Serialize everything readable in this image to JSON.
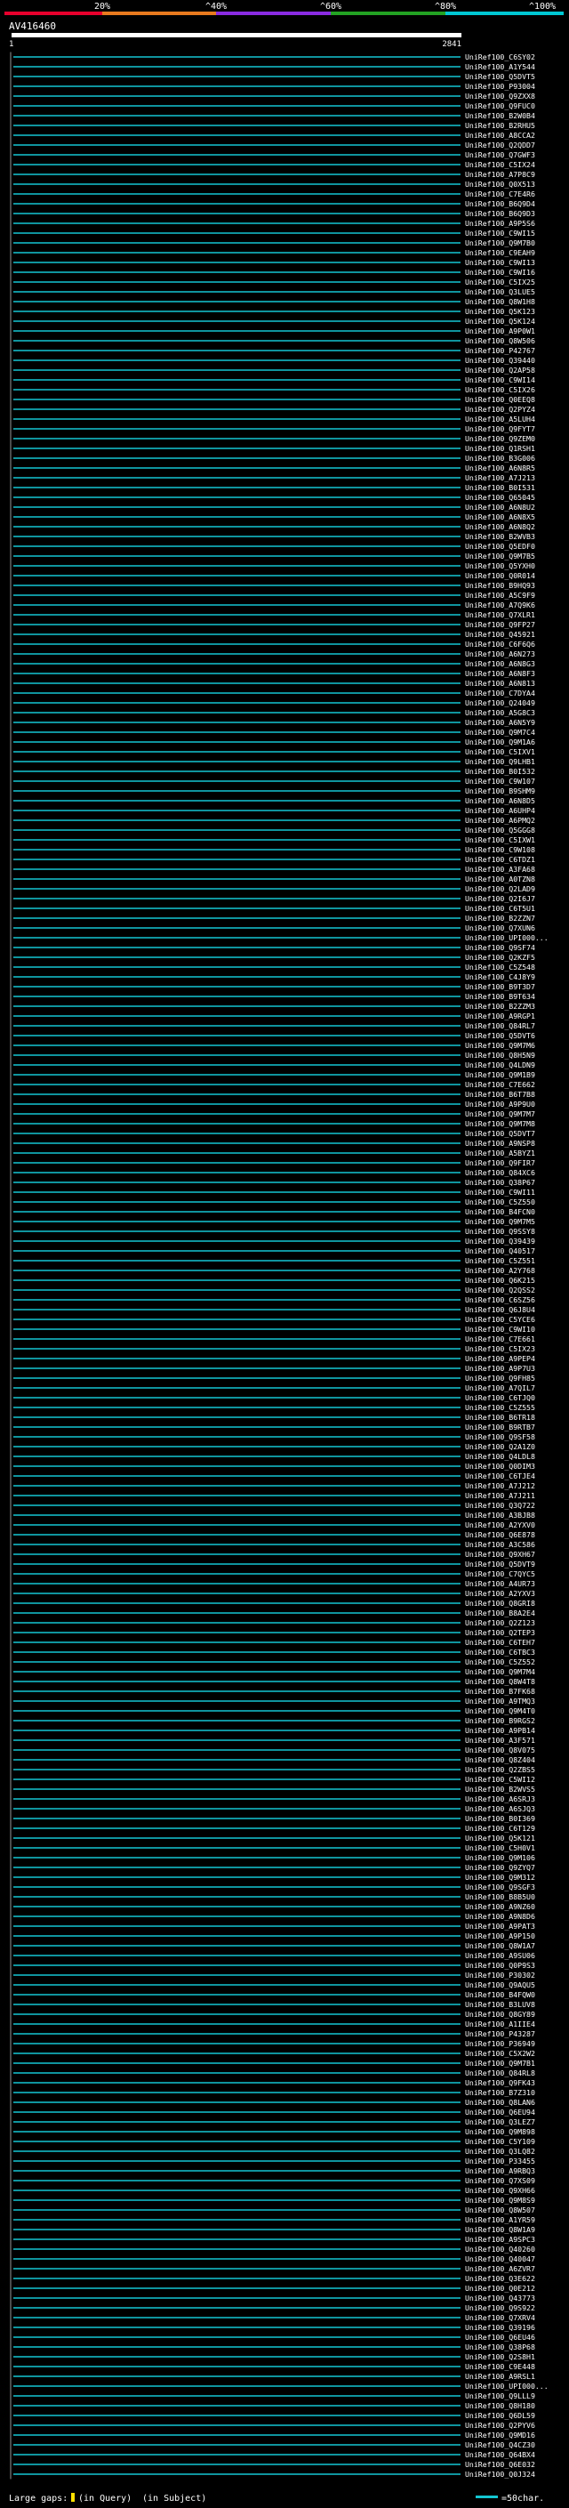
{
  "header": {
    "scale_labels": [
      "20%",
      "^40%",
      "^60%",
      "^80%",
      "^100%"
    ],
    "scale_colors": [
      "#e8002d",
      "#e87a1e",
      "#8a2be2",
      "#23a323",
      "#00c8d4"
    ],
    "query_id": "AV416460",
    "ruler_start": "1",
    "ruler_end": "2841"
  },
  "chart_data": {
    "type": "alignment",
    "query_length": 2841,
    "colors": {
      "high_identity": "#14c6d2",
      "mid_identity": "#3fae2a",
      "gap": "#ffffff",
      "frame": "#2a4a7a"
    },
    "hits": [
      "UniRef100_C6SY02",
      "UniRef100_A1Y544",
      "UniRef100_Q5DVT5",
      "UniRef100_P93004",
      "UniRef100_Q9ZXX8",
      "UniRef100_Q9FUC0",
      "UniRef100_B2W0B4",
      "UniRef100_B2RHU5",
      "UniRef100_A8CCA2",
      "UniRef100_Q2QDD7",
      "UniRef100_Q7GWF3",
      "UniRef100_C5IX24",
      "UniRef100_A7P8C9",
      "UniRef100_Q0X513",
      "UniRef100_C7E4R6",
      "UniRef100_B6Q9D4",
      "UniRef100_B6Q9D3",
      "UniRef100_A9P5S6",
      "UniRef100_C9WI15",
      "UniRef100_Q9M7B0",
      "UniRef100_C9EAH9",
      "UniRef100_C9WI13",
      "UniRef100_C9WI16",
      "UniRef100_C5IX25",
      "UniRef100_Q3LUE5",
      "UniRef100_Q8W1H8",
      "UniRef100_Q5K123",
      "UniRef100_Q5K124",
      "UniRef100_A9P0W1",
      "UniRef100_Q8W506",
      "UniRef100_P42767",
      "UniRef100_Q39440",
      "UniRef100_Q2AP58",
      "UniRef100_C9WI14",
      "UniRef100_C5IX26",
      "UniRef100_Q0EEQ8",
      "UniRef100_Q2PYZ4",
      "UniRef100_A5LUH4",
      "UniRef100_Q9FYT7",
      "UniRef100_Q9ZEM0",
      "UniRef100_Q1RSH1",
      "UniRef100_B3G006",
      "UniRef100_A6N8R5",
      "UniRef100_A7J213",
      "UniRef100_B0I531",
      "UniRef100_Q65045",
      "UniRef100_A6N8U2",
      "UniRef100_A6N8X5",
      "UniRef100_A6N8Q2",
      "UniRef100_B2WVB3",
      "UniRef100_Q5EDF0",
      "UniRef100_Q9M7B5",
      "UniRef100_Q5YXH0",
      "UniRef100_Q0R014",
      "UniRef100_B9HQ93",
      "UniRef100_A5C9F9",
      "UniRef100_A7Q9K6",
      "UniRef100_Q7XLR1",
      "UniRef100_Q9FP27",
      "UniRef100_Q45921",
      "UniRef100_C6F6Q6",
      "UniRef100_A6N273",
      "UniRef100_A6N8G3",
      "UniRef100_A6N8F3",
      "UniRef100_A6N813",
      "UniRef100_C7DYA4",
      "UniRef100_Q24049",
      "UniRef100_A5G8C3",
      "UniRef100_A6N5Y9",
      "UniRef100_Q9M7C4",
      "UniRef100_Q9M1A6",
      "UniRef100_C5IXV1",
      "UniRef100_Q9LHB1",
      "UniRef100_B0I532",
      "UniRef100_C9W107",
      "UniRef100_B9SHM9",
      "UniRef100_A6N8D5",
      "UniRef100_A6UHP4",
      "UniRef100_A6PMQ2",
      "UniRef100_Q5GGG8",
      "UniRef100_C5IXW1",
      "UniRef100_C9W108",
      "UniRef100_C6TDZ1",
      "UniRef100_A3FA68",
      "UniRef100_A0TZN8",
      "UniRef100_Q2LAD9",
      "UniRef100_Q2I6J7",
      "UniRef100_C6T5U1",
      "UniRef100_B2ZZN7",
      "UniRef100_Q7XUN6",
      "UniRef100_UPI000...",
      "UniRef100_Q9SF74",
      "UniRef100_Q2KZF5",
      "UniRef100_C5Z548",
      "UniRef100_C4J8Y9",
      "UniRef100_B9T3D7",
      "UniRef100_B9T634",
      "UniRef100_B2ZZM3",
      "UniRef100_A9RGP1",
      "UniRef100_Q84RL7",
      "UniRef100_Q5DVT6",
      "UniRef100_Q9M7M6",
      "UniRef100_Q8H5N9",
      "UniRef100_Q4LDN9",
      "UniRef100_Q9M1B9",
      "UniRef100_C7E662",
      "UniRef100_B6T7B8",
      "UniRef100_A9P9U0",
      "UniRef100_Q9M7M7",
      "UniRef100_Q9M7M8",
      "UniRef100_Q5DVT7",
      "UniRef100_A9NSP8",
      "UniRef100_A5BYZ1",
      "UniRef100_Q9FIR7",
      "UniRef100_Q84XC6",
      "UniRef100_Q38P67",
      "UniRef100_C9WI11",
      "UniRef100_C5Z550",
      "UniRef100_B4FCN0",
      "UniRef100_Q9M7M5",
      "UniRef100_Q9SSY8",
      "UniRef100_Q39439",
      "UniRef100_Q40517",
      "UniRef100_C5Z551",
      "UniRef100_A2Y768",
      "UniRef100_Q6K215",
      "UniRef100_Q2QSS2",
      "UniRef100_C6SZ56",
      "UniRef100_Q6J8U4",
      "UniRef100_C5YCE6",
      "UniRef100_C9WI10",
      "UniRef100_C7E661",
      "UniRef100_C5IX23",
      "UniRef100_A9PEP4",
      "UniRef100_A9P7U3",
      "UniRef100_Q9FH85",
      "UniRef100_A7QIL7",
      "UniRef100_C6TJQ0",
      "UniRef100_C5Z555",
      "UniRef100_B6TR18",
      "UniRef100_B9RTB7",
      "UniRef100_Q9SF58",
      "UniRef100_Q2A1Z0",
      "UniRef100_Q4LDL8",
      "UniRef100_Q0DIM3",
      "UniRef100_C6TJE4",
      "UniRef100_A7J212",
      "UniRef100_A7J211",
      "UniRef100_Q3Q722",
      "UniRef100_A3BJB8",
      "UniRef100_A2YXV0",
      "UniRef100_Q6E878",
      "UniRef100_A3C586",
      "UniRef100_Q9XH67",
      "UniRef100_Q5DVT9",
      "UniRef100_C7QYC5",
      "UniRef100_A4UR73",
      "UniRef100_A2YXV3",
      "UniRef100_Q8GRI8",
      "UniRef100_B8A2E4",
      "UniRef100_Q2Z123",
      "UniRef100_Q2TEP3",
      "UniRef100_C6TEH7",
      "UniRef100_C6TBC3",
      "UniRef100_C5Z552",
      "UniRef100_Q9M7M4",
      "UniRef100_Q8W4T8",
      "UniRef100_B7FK68",
      "UniRef100_A9TMQ3",
      "UniRef100_Q9M4T0",
      "UniRef100_B9RGS2",
      "UniRef100_A9PB14",
      "UniRef100_A3F571",
      "UniRef100_Q8V075",
      "UniRef100_Q8Z404",
      "UniRef100_Q2ZBS5",
      "UniRef100_C5WI12",
      "UniRef100_B2WVS5",
      "UniRef100_A6SRJ3",
      "UniRef100_A6SJQ3",
      "UniRef100_B0I369",
      "UniRef100_C6T129",
      "UniRef100_Q5K121",
      "UniRef100_C5H0V1",
      "UniRef100_Q9M106",
      "UniRef100_Q9ZYQ7",
      "UniRef100_Q9M312",
      "UniRef100_Q9SGF3",
      "UniRef100_B8B5U0",
      "UniRef100_A9NZ60",
      "UniRef100_A9N8D6",
      "UniRef100_A9PAT3",
      "UniRef100_A9P150",
      "UniRef100_Q8W1A7",
      "UniRef100_A9SU06",
      "UniRef100_Q0P9S3",
      "UniRef100_P30302",
      "UniRef100_Q9AQU5",
      "UniRef100_B4FQW0",
      "UniRef100_B3LUV8",
      "UniRef100_Q8GY89",
      "UniRef100_A1IIE4",
      "UniRef100_P43287",
      "UniRef100_P36949",
      "UniRef100_C5X2W2",
      "UniRef100_Q9M7B1",
      "UniRef100_Q84RL8",
      "UniRef100_Q9FK43",
      "UniRef100_B7Z310",
      "UniRef100_Q8LAN6",
      "UniRef100_Q6EU94",
      "UniRef100_Q3LEZ7",
      "UniRef100_Q9M898",
      "UniRef100_C5Y109",
      "UniRef100_Q3LQ82",
      "UniRef100_P33455",
      "UniRef100_A9RBQ3",
      "UniRef100_Q7XS09",
      "UniRef100_Q9XH66",
      "UniRef100_Q9M8S9",
      "UniRef100_Q8W507",
      "UniRef100_A1YR59",
      "UniRef100_Q8W1A9",
      "UniRef100_A9SPC3",
      "UniRef100_Q40260",
      "UniRef100_Q40047",
      "UniRef100_A6ZVR7",
      "UniRef100_Q3E622",
      "UniRef100_Q0E212",
      "UniRef100_Q43773",
      "UniRef100_Q9S922",
      "UniRef100_Q7XRV4",
      "UniRef100_Q39196",
      "UniRef100_Q6EU46",
      "UniRef100_Q38P68",
      "UniRef100_Q2S8H1",
      "UniRef100_C9E448",
      "UniRef100_A9RSL1",
      "UniRef100_UPI000...",
      "UniRef100_Q9LLL9",
      "UniRef100_Q8H180",
      "UniRef100_Q6DL59",
      "UniRef100_Q2PYV6",
      "UniRef100_Q9MD16",
      "UniRef100_Q4CZ30",
      "UniRef100_Q64BX4",
      "UniRef100_Q6E032",
      "UniRef100_Q0J324"
    ]
  },
  "legend": {
    "large_gaps_label": "Large gaps:",
    "in_query_label": "(in Query)",
    "in_subject_label": "(in Subject)",
    "scale_label": "=50char."
  }
}
